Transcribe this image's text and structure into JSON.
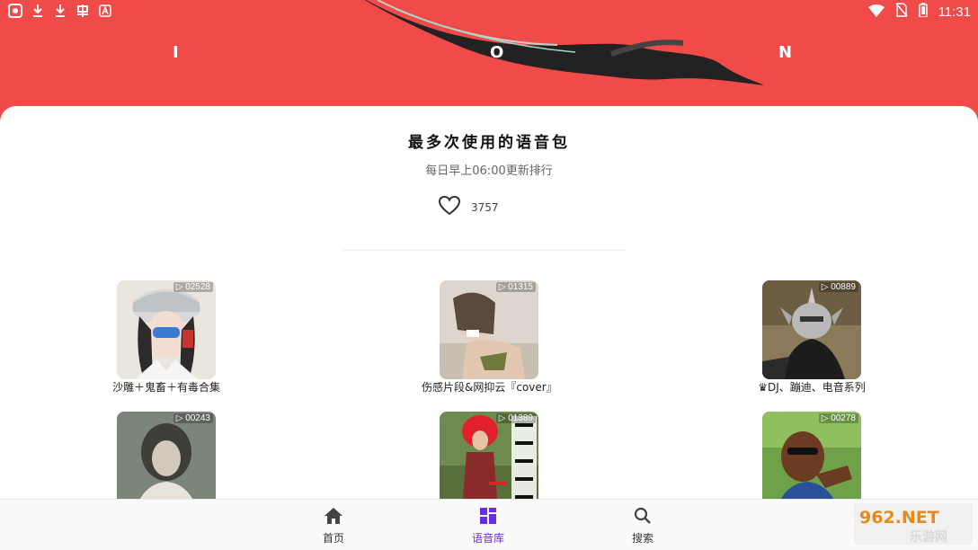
{
  "status_bar": {
    "time": "11:31",
    "left_icons": [
      "app-icon",
      "download-icon",
      "download-icon",
      "bug-icon",
      "a-icon"
    ],
    "right_icons": [
      "wifi-icon",
      "no-sim-icon",
      "battery-icon"
    ]
  },
  "banner": {
    "letters": [
      "I",
      "O",
      "N"
    ],
    "color": "#f04a49"
  },
  "ranking": {
    "title": "最多次使用的语音包",
    "subtitle": "每日早上06:00更新排行",
    "likes": "3757"
  },
  "items": [
    {
      "plays": "02528",
      "label": "沙雕＋鬼畜＋有毒合集"
    },
    {
      "plays": "01315",
      "label": "伤感片段&网抑云『cover』"
    },
    {
      "plays": "00889",
      "label": "♛DJ、蹦迪、电音系列"
    },
    {
      "plays": "00243",
      "label": ""
    },
    {
      "plays": "01389",
      "label": ""
    },
    {
      "plays": "00278",
      "label": ""
    }
  ],
  "nav": {
    "home": "首页",
    "library": "语音库",
    "search": "搜索",
    "active_color": "#6a2ee8"
  },
  "watermark": {
    "line1": "962.NET",
    "line2": "乐游网"
  }
}
